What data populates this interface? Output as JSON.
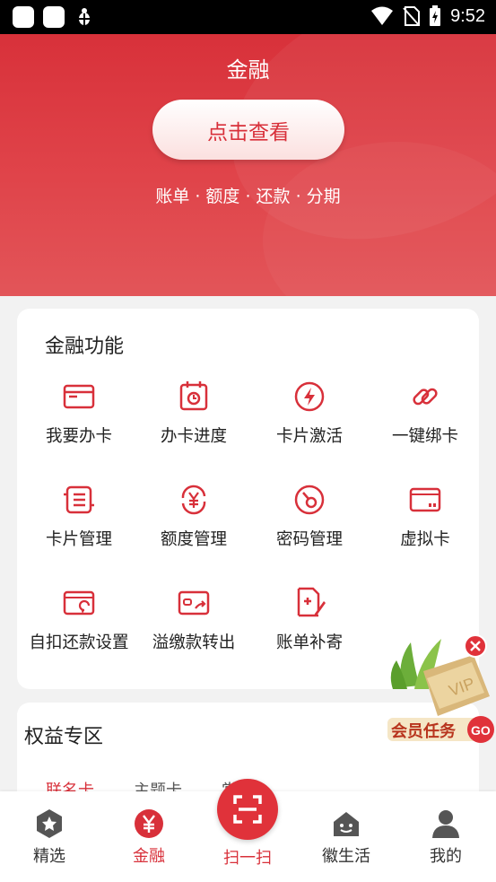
{
  "status_bar": {
    "time": "9:52"
  },
  "hero": {
    "title": "金融",
    "button_label": "点击查看",
    "subtitle": "账单 · 额度 · 还款 · 分期"
  },
  "finance": {
    "title": "金融功能",
    "items": [
      {
        "label": "我要办卡",
        "icon": "card-icon"
      },
      {
        "label": "办卡进度",
        "icon": "calendar-progress-icon"
      },
      {
        "label": "卡片激活",
        "icon": "lightning-icon"
      },
      {
        "label": "一键绑卡",
        "icon": "link-icon"
      },
      {
        "label": "卡片管理",
        "icon": "list-icon"
      },
      {
        "label": "额度管理",
        "icon": "yen-cycle-icon"
      },
      {
        "label": "密码管理",
        "icon": "key-icon"
      },
      {
        "label": "虚拟卡",
        "icon": "virtual-card-icon"
      },
      {
        "label": "自扣还款设置",
        "icon": "auto-repay-icon"
      },
      {
        "label": "溢缴款转出",
        "icon": "wallet-transfer-icon"
      },
      {
        "label": "账单补寄",
        "icon": "edit-bill-icon"
      }
    ]
  },
  "rights": {
    "title": "权益专区",
    "tabs": [
      "联名卡",
      "主题卡",
      "赏卡"
    ]
  },
  "promo": {
    "text": "会员任务",
    "go": "GO",
    "badge": "VIP"
  },
  "nav": {
    "items": [
      {
        "label": "精选"
      },
      {
        "label": "金融"
      },
      {
        "label": "扫一扫"
      },
      {
        "label": "徽生活"
      },
      {
        "label": "我的"
      }
    ]
  },
  "colors": {
    "accent": "#d8303a",
    "hero": "#e0444a",
    "background": "#f2f2f2"
  }
}
